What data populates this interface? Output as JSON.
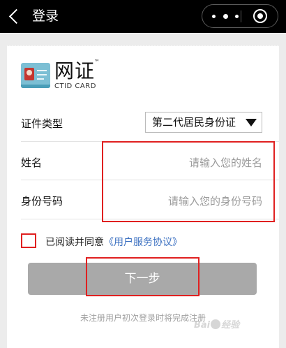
{
  "topbar": {
    "title": "登录"
  },
  "logo": {
    "cn": "网证",
    "tm": "™",
    "en": "CTID CARD"
  },
  "form": {
    "cert_type_label": "证件类型",
    "cert_type_value": "第二代居民身份证",
    "name_label": "姓名",
    "name_placeholder": "请输入您的姓名",
    "id_label": "身份号码",
    "id_placeholder": "请输入您的身份号码"
  },
  "agreement": {
    "prefix": "已阅读并同意",
    "link": "《用户服务协议》"
  },
  "next_button": "下一步",
  "footer": "未注册用户初次登录时将完成注册",
  "watermark": {
    "left": "Bai",
    "right": "经验"
  },
  "colors": {
    "annotation": "#e02020",
    "link": "#3a6fc0",
    "button": "#a9a9a9"
  }
}
